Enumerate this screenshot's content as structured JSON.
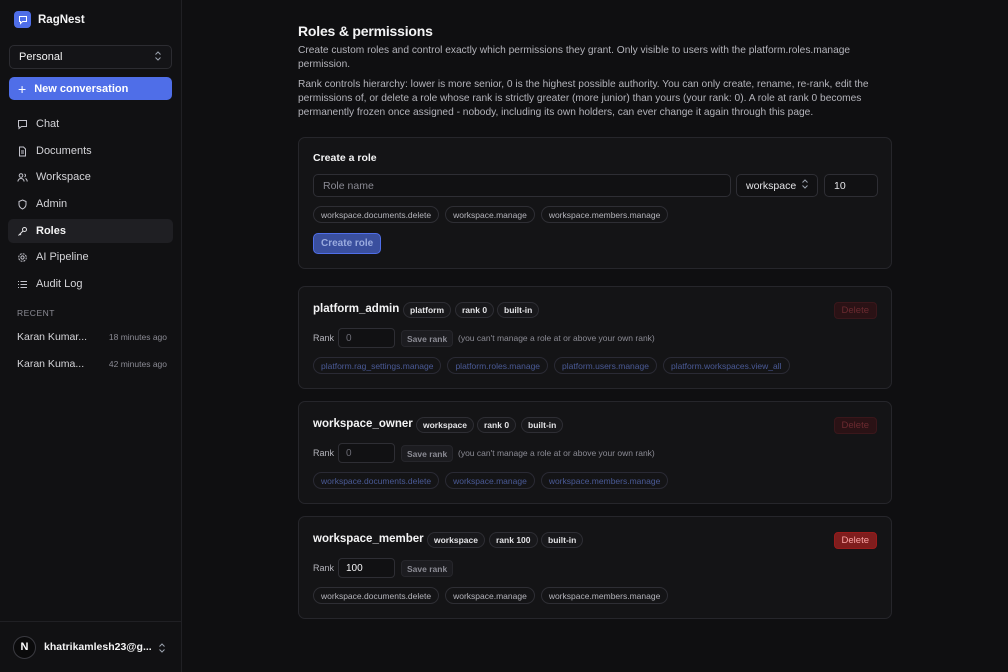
{
  "app": {
    "name": "RagNest"
  },
  "sidebar": {
    "workspace_select": "Personal",
    "new_conversation": "New conversation",
    "nav": [
      {
        "label": "Chat",
        "icon": "chat-icon"
      },
      {
        "label": "Documents",
        "icon": "document-icon"
      },
      {
        "label": "Workspace",
        "icon": "users-icon"
      },
      {
        "label": "Admin",
        "icon": "shield-icon"
      },
      {
        "label": "Roles",
        "icon": "key-icon",
        "active": true
      },
      {
        "label": "AI Pipeline",
        "icon": "gear-icon"
      },
      {
        "label": "Audit Log",
        "icon": "list-icon"
      }
    ],
    "recent_label": "RECENT",
    "recent": [
      {
        "title": "Karan Kumar...",
        "time": "18 minutes ago"
      },
      {
        "title": "Karan Kuma...",
        "time": "42 minutes ago"
      }
    ],
    "user": {
      "initial": "N",
      "email": "khatrikamlesh23@g..."
    }
  },
  "main": {
    "title": "Roles & permissions",
    "description1": "Create custom roles and control exactly which permissions they grant. Only visible to users with the platform.roles.manage permission.",
    "description2": "Rank controls hierarchy: lower is more senior, 0 is the highest possible authority. You can only create, rename, re-rank, edit the permissions of, or delete a role whose rank is strictly greater (more junior) than yours (your rank: 0). A role at rank 0 becomes permanently frozen once assigned - nobody, including its own holders, can ever change it again through this page.",
    "create": {
      "title": "Create a role",
      "name_placeholder": "Role name",
      "scope": "workspace",
      "rank": "10",
      "permissions": [
        "workspace.documents.delete",
        "workspace.manage",
        "workspace.members.manage"
      ],
      "button": "Create role"
    },
    "roles": [
      {
        "name": "platform_admin",
        "scope": "platform",
        "rank_badge": "rank 0",
        "builtin": "built-in",
        "rank_label": "Rank",
        "rank_value": "0",
        "save": "Save rank",
        "note": "(you can't manage a role at or above your own rank)",
        "permissions": [
          "platform.rag_settings.manage",
          "platform.roles.manage",
          "platform.users.manage",
          "platform.workspaces.view_all"
        ],
        "delete": "Delete"
      },
      {
        "name": "workspace_owner",
        "scope": "workspace",
        "rank_badge": "rank 0",
        "builtin": "built-in",
        "rank_label": "Rank",
        "rank_value": "0",
        "save": "Save rank",
        "note": "(you can't manage a role at or above your own rank)",
        "permissions": [
          "workspace.documents.delete",
          "workspace.manage",
          "workspace.members.manage"
        ],
        "delete": "Delete"
      },
      {
        "name": "workspace_member",
        "scope": "workspace",
        "rank_badge": "rank 100",
        "builtin": "built-in",
        "rank_label": "Rank",
        "rank_value": "100",
        "save": "Save rank",
        "permissions": [
          "workspace.documents.delete",
          "workspace.manage",
          "workspace.members.manage"
        ],
        "delete": "Delete"
      }
    ]
  }
}
